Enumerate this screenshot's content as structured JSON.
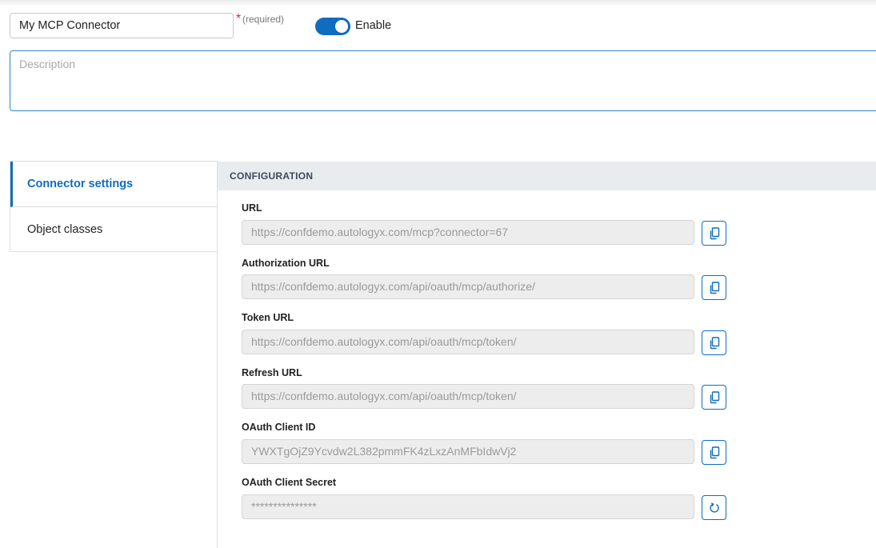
{
  "connector": {
    "name_value": "My MCP Connector",
    "required_star": "*",
    "required_text": "(required)",
    "enable_label": "Enable",
    "enabled": true,
    "description_placeholder": "Description"
  },
  "sidebar": {
    "items": [
      {
        "label": "Connector settings",
        "active": true
      },
      {
        "label": "Object classes",
        "active": false
      }
    ]
  },
  "configuration": {
    "header": "CONFIGURATION",
    "fields": [
      {
        "label": "URL",
        "value": "https://confdemo.autologyx.com/mcp?connector=67",
        "action_icon": "copy-icon"
      },
      {
        "label": "Authorization URL",
        "value": "https://confdemo.autologyx.com/api/oauth/mcp/authorize/",
        "action_icon": "copy-icon"
      },
      {
        "label": "Token URL",
        "value": "https://confdemo.autologyx.com/api/oauth/mcp/token/",
        "action_icon": "copy-icon"
      },
      {
        "label": "Refresh URL",
        "value": "https://confdemo.autologyx.com/api/oauth/mcp/token/",
        "action_icon": "copy-icon"
      },
      {
        "label": "OAuth Client ID",
        "value": "YWXTgOjZ9Ycvdw2L382pmmFK4zLxzAnMFbIdwVj2",
        "action_icon": "copy-icon"
      },
      {
        "label": "OAuth Client Secret",
        "value": "***************",
        "action_icon": "refresh-icon"
      }
    ]
  },
  "colors": {
    "accent": "#0f6cbf",
    "header_bg": "#e9ecef",
    "readonly_bg": "#ededed"
  }
}
